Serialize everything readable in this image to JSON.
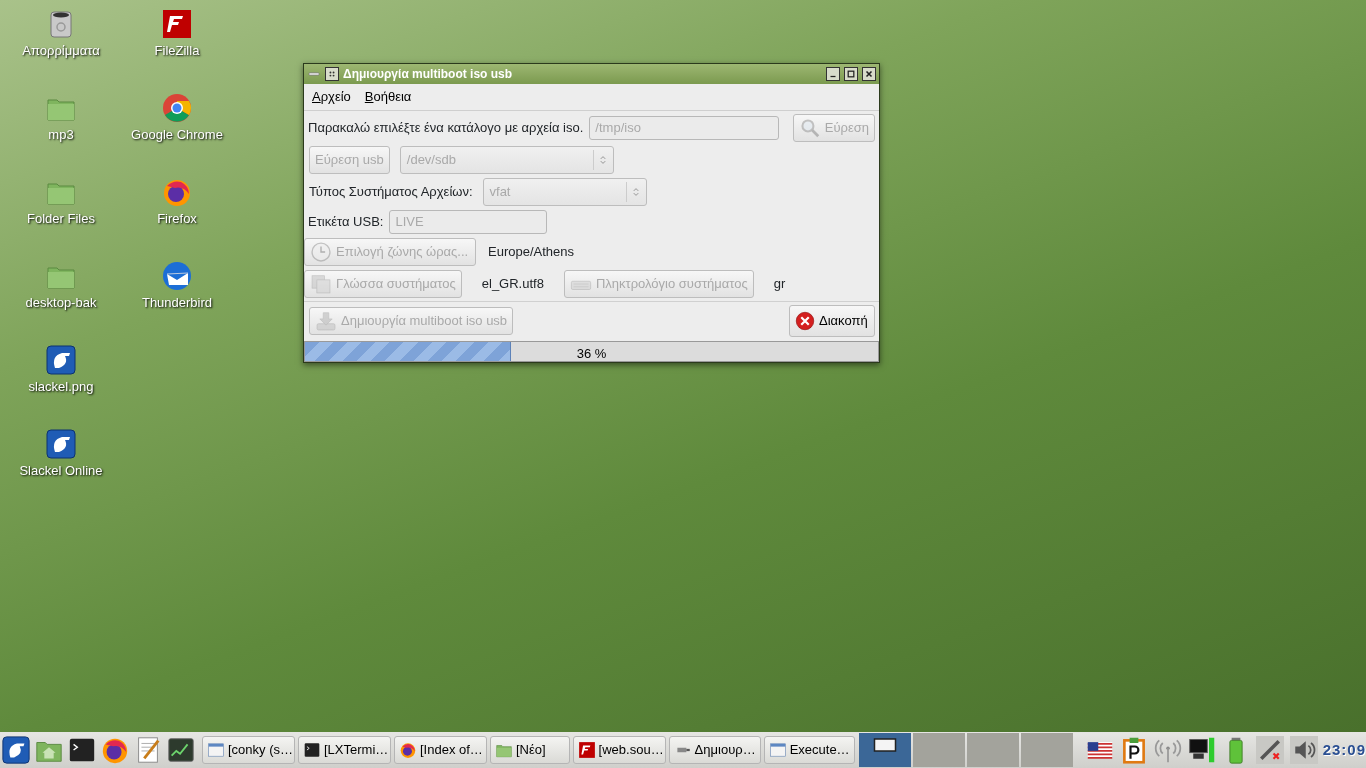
{
  "desktop_icons": [
    {
      "label": "Απορρίμματα",
      "kind": "trash"
    },
    {
      "label": "mp3",
      "kind": "folder"
    },
    {
      "label": "Folder Files",
      "kind": "folder"
    },
    {
      "label": "desktop-bak",
      "kind": "folder"
    },
    {
      "label": "slackel.png",
      "kind": "logo"
    },
    {
      "label": "Slackel Online",
      "kind": "logo"
    },
    {
      "label": "FileZilla",
      "kind": "filezilla"
    },
    {
      "label": "Google Chrome",
      "kind": "chrome"
    },
    {
      "label": "Firefox",
      "kind": "firefox"
    },
    {
      "label": "Thunderbird",
      "kind": "thunderbird"
    }
  ],
  "window": {
    "title": "Δημιουργία multiboot iso usb",
    "menu": [
      "Αρχείο",
      "Βοήθεια"
    ],
    "iso_prompt": "Παρακαλώ επιλέξτε ένα κατάλογο με αρχεία iso.",
    "iso_dir": {
      "value": "/tmp/iso",
      "disabled": true
    },
    "find_button": {
      "label": "Εύρεση",
      "disabled": true
    },
    "usb_button": {
      "label": "Εύρεση usb",
      "disabled": true
    },
    "device_select": {
      "value": "/dev/sdb",
      "disabled": true
    },
    "fs_label": "Τύπος Συστήματος Αρχείων:",
    "fs_select": {
      "value": "vfat",
      "disabled": true
    },
    "usb_label_label": "Ετικέτα USB:",
    "usb_label": {
      "value": "LIVE",
      "disabled": true
    },
    "timezone_button": {
      "label": "Επιλογή ζώνης ώρας...",
      "disabled": true
    },
    "timezone": "Europe/Athens",
    "language_button": {
      "label": "Γλώσσα συστήματος",
      "disabled": true
    },
    "language": "el_GR.utf8",
    "keyboard_button": {
      "label": "Πληκτρολόγιο συστήματος",
      "disabled": true
    },
    "keyboard": "gr",
    "create_button": {
      "label": "Δημιουργία multiboot iso usb",
      "disabled": true
    },
    "cancel_button": {
      "label": "Διακοπή",
      "disabled": false
    },
    "progress": {
      "level": 0.36,
      "text": "36 %"
    }
  },
  "taskbar": {
    "tasks": [
      {
        "label": "[conky (s…",
        "kind": "window"
      },
      {
        "label": "[LXTermi…",
        "kind": "terminal"
      },
      {
        "label": "[Index of…",
        "kind": "firefox"
      },
      {
        "label": "[Νέο]",
        "kind": "folder"
      },
      {
        "label": "[web.sou…",
        "kind": "filezilla"
      },
      {
        "label": "Δημιουρ…",
        "kind": "usb"
      },
      {
        "label": "Execute…",
        "kind": "window"
      }
    ],
    "desktops": [
      {
        "selected": true
      },
      {
        "selected": false
      },
      {
        "selected": false
      },
      {
        "selected": false
      }
    ],
    "clock": "23:09"
  }
}
